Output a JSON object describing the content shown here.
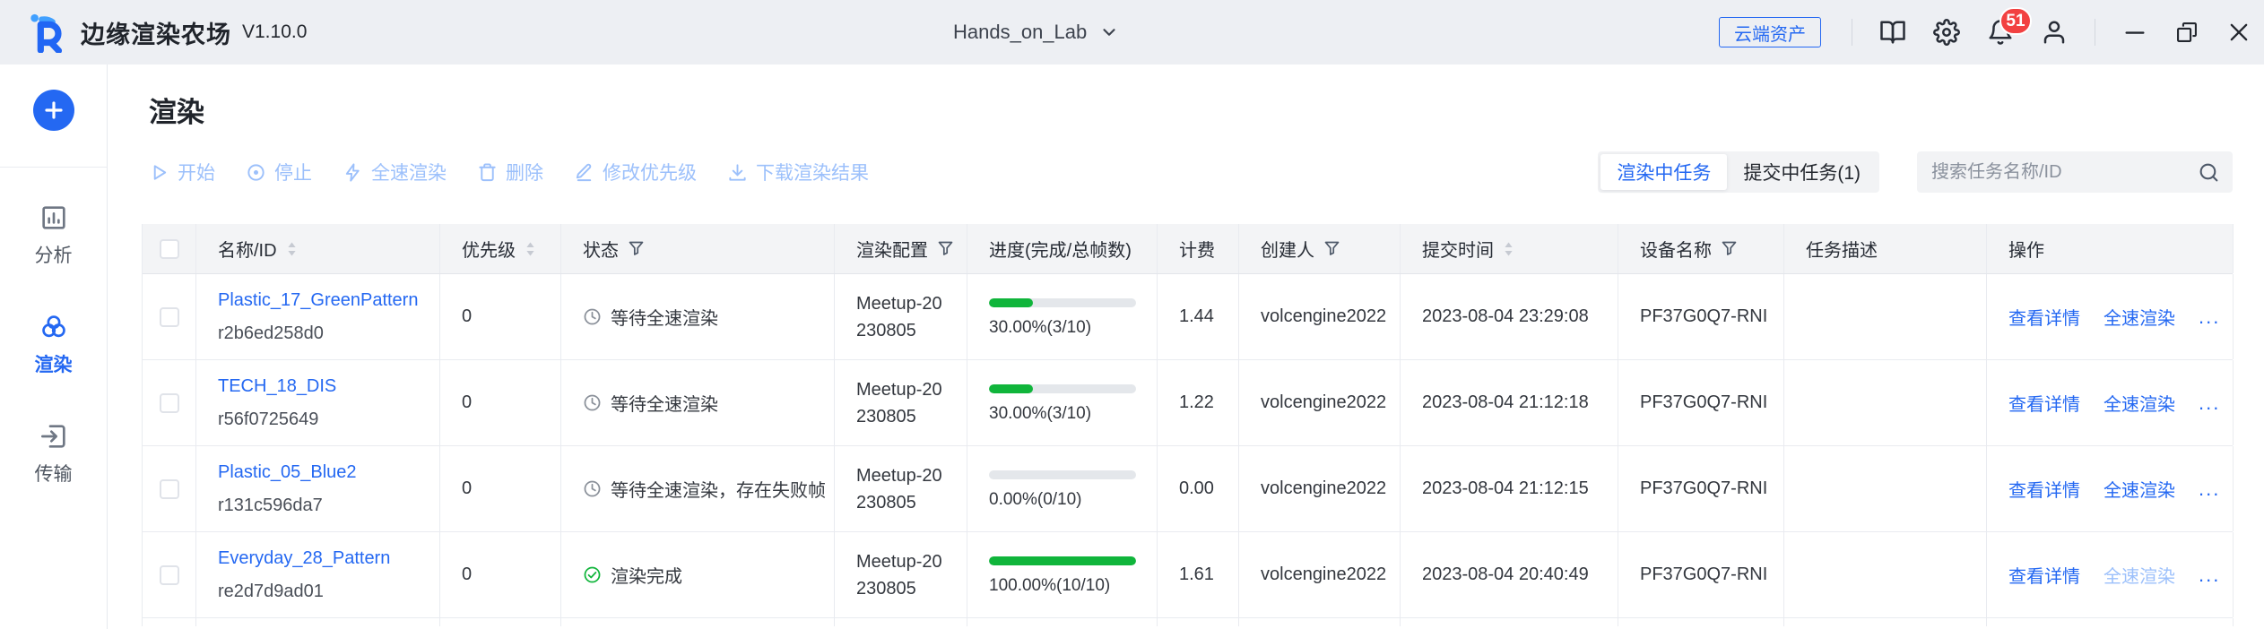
{
  "topbar": {
    "brand": "边缘渲染农场",
    "version": "V1.10.0",
    "workspace": "Hands_on_Lab",
    "cloud_assets_label": "云端资产",
    "notification_badge": "51"
  },
  "sidebar": {
    "items": [
      {
        "label": "分析",
        "icon": "bar-chart-icon",
        "active": false
      },
      {
        "label": "渲染",
        "icon": "render-circles-icon",
        "active": true
      },
      {
        "label": "传输",
        "icon": "transfer-icon",
        "active": false
      }
    ]
  },
  "page": {
    "title": "渲染",
    "actions": [
      {
        "label": "开始",
        "icon": "play-icon"
      },
      {
        "label": "停止",
        "icon": "stop-icon"
      },
      {
        "label": "全速渲染",
        "icon": "lightning-icon"
      },
      {
        "label": "删除",
        "icon": "trash-icon"
      },
      {
        "label": "修改优先级",
        "icon": "edit-icon"
      },
      {
        "label": "下载渲染结果",
        "icon": "download-icon"
      }
    ],
    "tabs": [
      {
        "label": "渲染中任务",
        "active": true
      },
      {
        "label": "提交中任务(1)",
        "active": false
      }
    ],
    "search_placeholder": "搜索任务名称/ID"
  },
  "table": {
    "columns": [
      {
        "key": "select",
        "label": "",
        "type": "checkbox"
      },
      {
        "key": "name-id",
        "label": "名称/ID",
        "sortable": true
      },
      {
        "key": "priority",
        "label": "优先级",
        "sortable": true
      },
      {
        "key": "status",
        "label": "状态",
        "filterable": true
      },
      {
        "key": "render-config",
        "label": "渲染配置",
        "filterable": true
      },
      {
        "key": "progress",
        "label": "进度(完成/总帧数)"
      },
      {
        "key": "billing",
        "label": "计费"
      },
      {
        "key": "creator",
        "label": "创建人",
        "filterable": true
      },
      {
        "key": "submit-time",
        "label": "提交时间",
        "sortable": true
      },
      {
        "key": "device-name",
        "label": "设备名称",
        "filterable": true
      },
      {
        "key": "description",
        "label": "任务描述"
      },
      {
        "key": "operations",
        "label": "操作"
      }
    ],
    "rows": [
      {
        "name": "Plastic_17_GreenPattern",
        "id": "r2b6ed258d0",
        "priority": "0",
        "status": "等待全速渲染",
        "status_icon": "clock-icon",
        "config": "Meetup-20230805",
        "progress_percent": 30,
        "progress_text": "30.00%(3/10)",
        "billing": "1.44",
        "creator": "volcengine2022",
        "submitted": "2023-08-04 23:29:08",
        "device": "PF37G0Q7-RNI",
        "description": "",
        "actions": {
          "view": "查看详情",
          "full_speed": "全速渲染",
          "more": "...",
          "full_speed_disabled": false
        }
      },
      {
        "name": "TECH_18_DIS",
        "id": "r56f0725649",
        "priority": "0",
        "status": "等待全速渲染",
        "status_icon": "clock-icon",
        "config": "Meetup-20230805",
        "progress_percent": 30,
        "progress_text": "30.00%(3/10)",
        "billing": "1.22",
        "creator": "volcengine2022",
        "submitted": "2023-08-04 21:12:18",
        "device": "PF37G0Q7-RNI",
        "description": "",
        "actions": {
          "view": "查看详情",
          "full_speed": "全速渲染",
          "more": "...",
          "full_speed_disabled": false
        }
      },
      {
        "name": "Plastic_05_Blue2",
        "id": "r131c596da7",
        "priority": "0",
        "status": "等待全速渲染，存在失败帧",
        "status_icon": "clock-icon",
        "config": "Meetup-20230805",
        "progress_percent": 0,
        "progress_text": "0.00%(0/10)",
        "billing": "0.00",
        "creator": "volcengine2022",
        "submitted": "2023-08-04 21:12:15",
        "device": "PF37G0Q7-RNI",
        "description": "",
        "actions": {
          "view": "查看详情",
          "full_speed": "全速渲染",
          "more": "...",
          "full_speed_disabled": false
        }
      },
      {
        "name": "Everyday_28_Pattern",
        "id": "re2d7d9ad01",
        "priority": "0",
        "status": "渲染完成",
        "status_icon": "check-circle-icon",
        "config": "Meetup-20230805",
        "progress_percent": 100,
        "progress_text": "100.00%(10/10)",
        "billing": "1.61",
        "creator": "volcengine2022",
        "submitted": "2023-08-04 20:40:49",
        "device": "PF37G0Q7-RNI",
        "description": "",
        "actions": {
          "view": "查看详情",
          "full_speed": "全速渲染",
          "more": "...",
          "full_speed_disabled": true
        }
      }
    ]
  },
  "colors": {
    "accent": "#2468f2",
    "accent_disabled": "#9cc0fb",
    "success_green": "#10b53b",
    "badge_red": "#f24141",
    "topbar_gray": "#edeff3"
  }
}
